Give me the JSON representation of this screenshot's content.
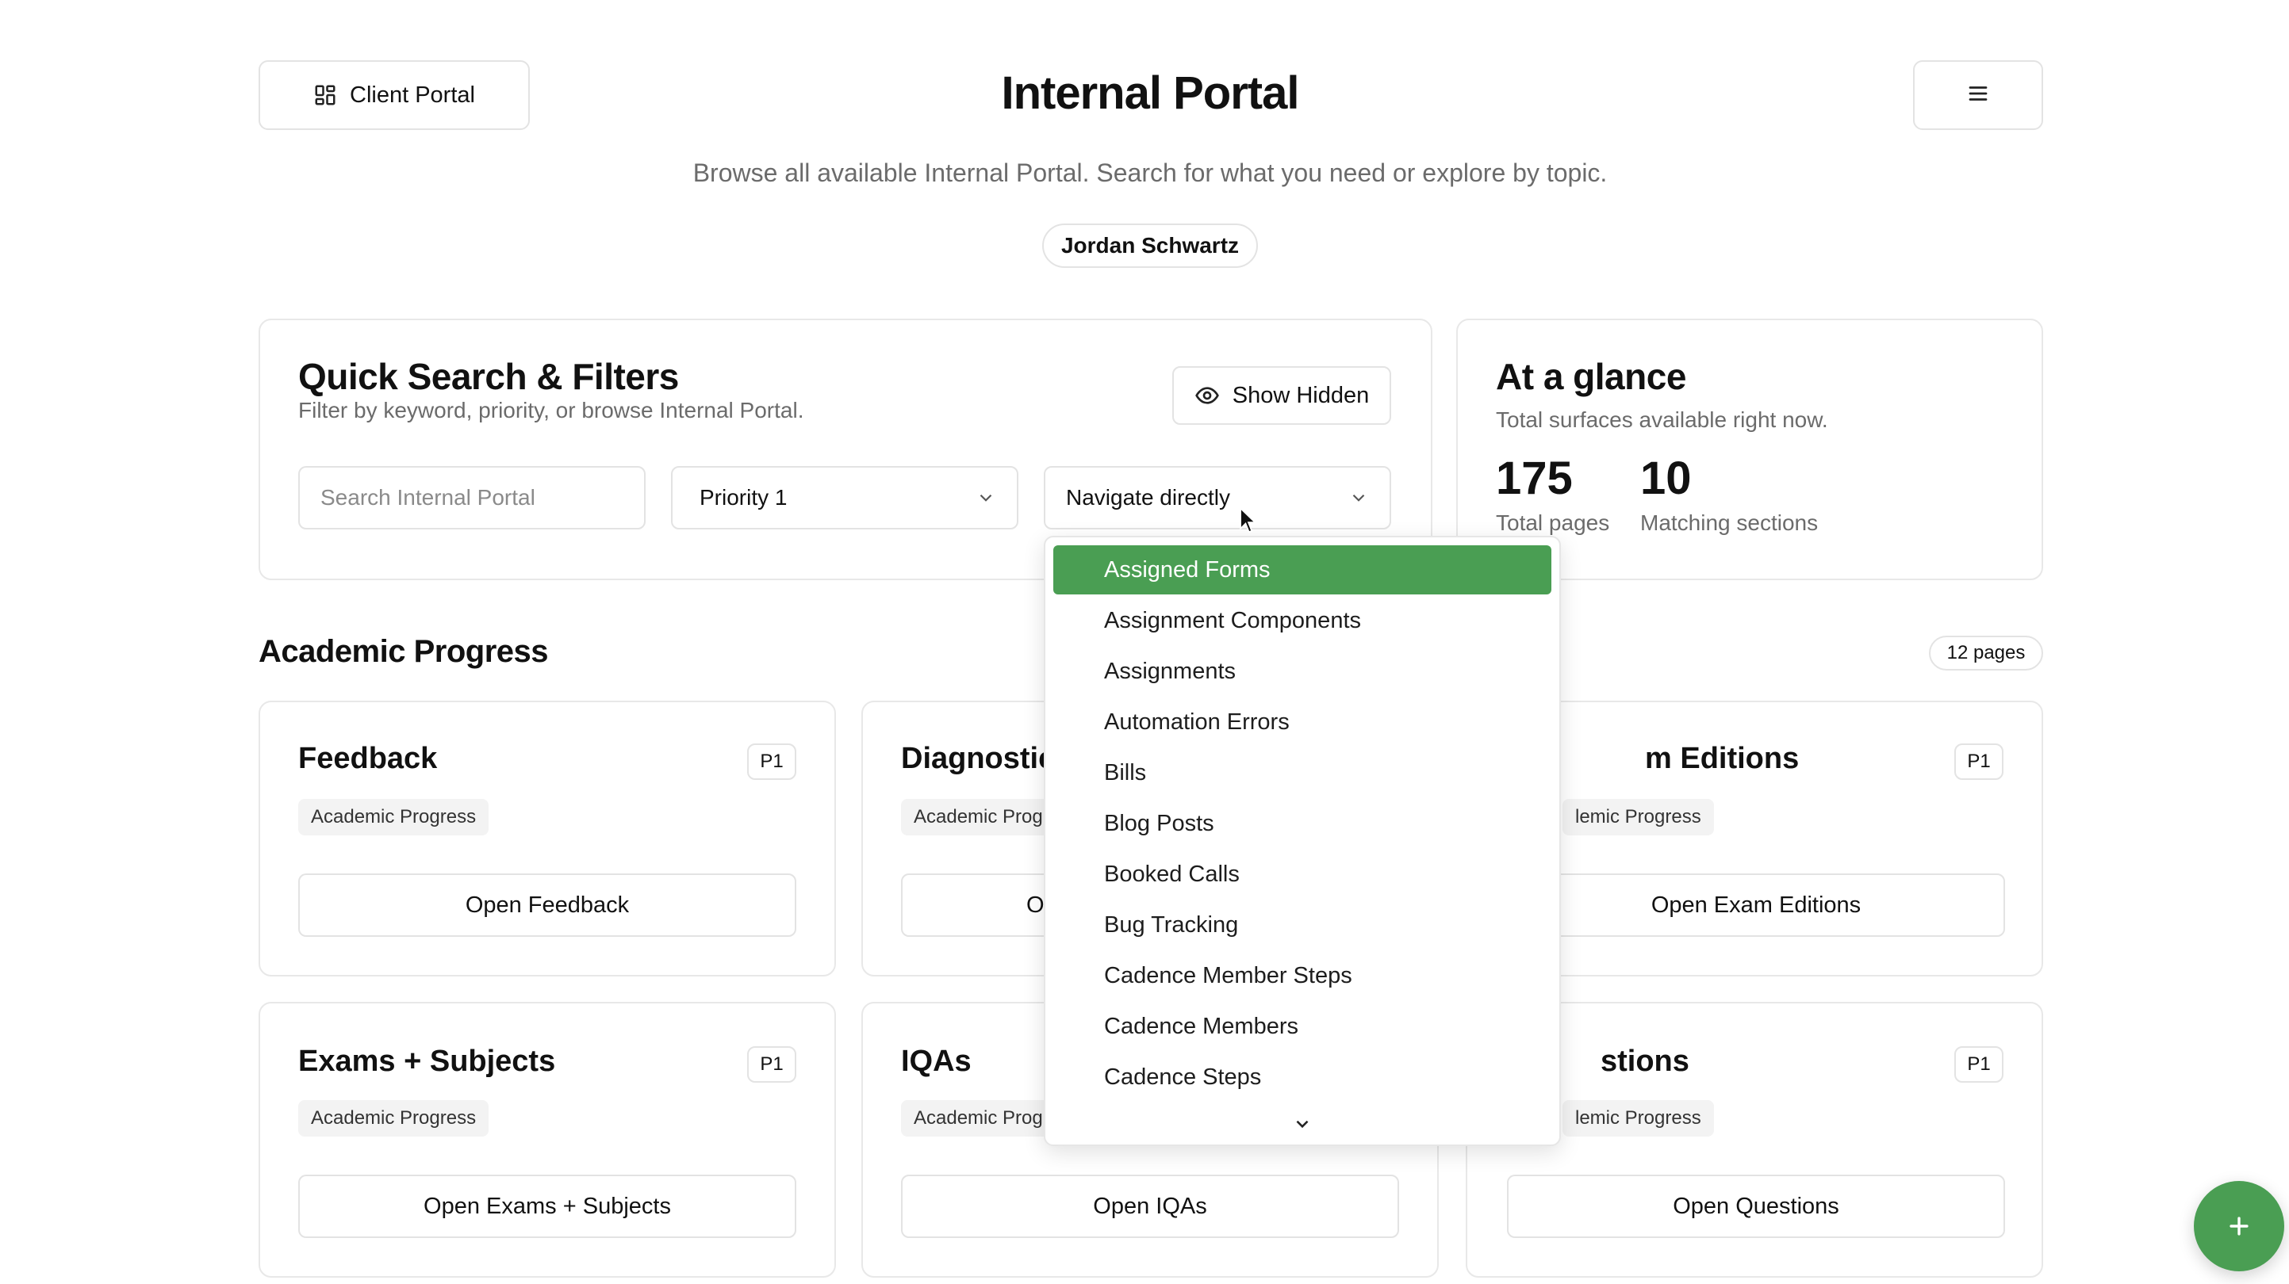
{
  "header": {
    "client_portal_label": "Client Portal",
    "title": "Internal Portal",
    "subtitle": "Browse all available Internal Portal. Search for what you need or explore by topic.",
    "user_name": "Jordan Schwartz"
  },
  "filters": {
    "title": "Quick Search & Filters",
    "description": "Filter by keyword, priority, or browse Internal Portal.",
    "show_hidden_label": "Show Hidden",
    "search_placeholder": "Search Internal Portal",
    "priority_value": "Priority 1",
    "navigate_value": "Navigate directly"
  },
  "glance": {
    "title": "At a glance",
    "description": "Total surfaces available right now.",
    "total_pages_value": "175",
    "total_pages_label": "Total pages",
    "matching_value": "10",
    "matching_label": "Matching sections"
  },
  "section": {
    "title": "Academic Progress",
    "count_badge": "12 pages"
  },
  "cards": [
    {
      "title": "Feedback",
      "priority": "P1",
      "tag": "Academic Progress",
      "button": "Open Feedback"
    },
    {
      "title": "Diagnostic",
      "priority": "",
      "tag": "Academic Prog",
      "button": "O"
    },
    {
      "title": "m Editions",
      "priority": "P1",
      "tag": "lemic Progress",
      "button": "Open Exam Editions"
    },
    {
      "title": "Exams + Subjects",
      "priority": "P1",
      "tag": "Academic Progress",
      "button": "Open Exams + Subjects"
    },
    {
      "title": "IQAs",
      "priority": "",
      "tag": "Academic Prog",
      "button": "Open IQAs"
    },
    {
      "title": "stions",
      "priority": "P1",
      "tag": "lemic Progress",
      "button": "Open Questions"
    }
  ],
  "dropdown": {
    "items": [
      "Assigned Forms",
      "Assignment Components",
      "Assignments",
      "Automation Errors",
      "Bills",
      "Blog Posts",
      "Booked Calls",
      "Bug Tracking",
      "Cadence Member Steps",
      "Cadence Members",
      "Cadence Steps"
    ],
    "selected": "Assigned Forms"
  },
  "fab": {
    "icon": "plus-icon"
  },
  "colors": {
    "accent": "#4a9e53",
    "border": "#e3e3e3",
    "muted": "#6b6b6b"
  }
}
